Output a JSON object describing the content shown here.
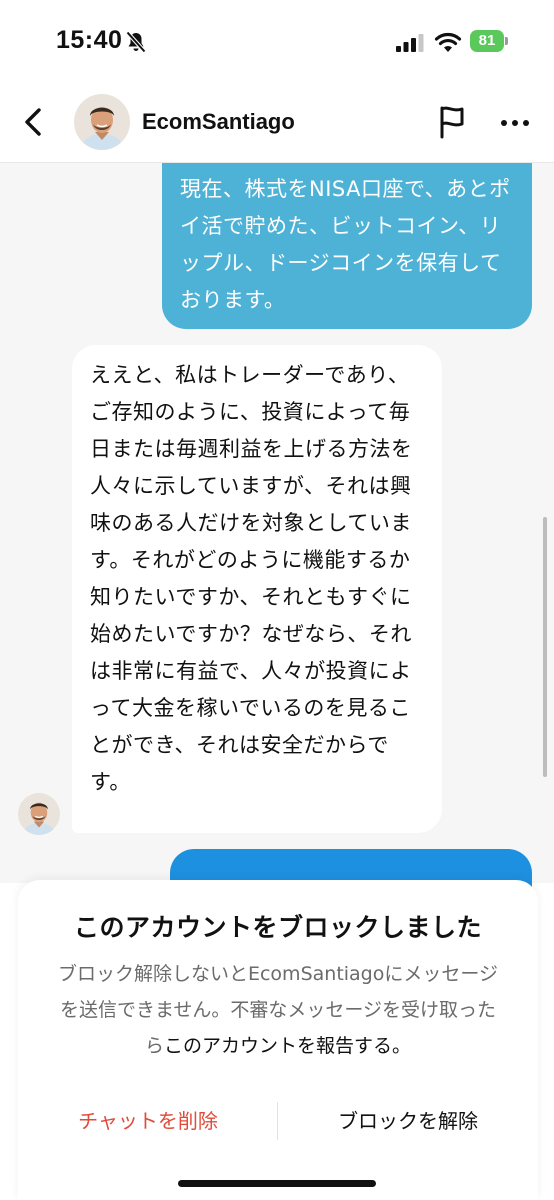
{
  "status_bar": {
    "time": "15:40",
    "battery": "81",
    "icons": [
      "bell-slash-icon",
      "signal-icon",
      "wifi-icon",
      "battery-icon"
    ],
    "battery_color": "#5ac85a"
  },
  "header": {
    "username": "EcomSantiago",
    "icons": [
      "chevron-left-icon",
      "flag-icon",
      "more-icon"
    ]
  },
  "messages": {
    "outgoing_1": "現在、株式をNISA口座で、あとポイ活で貯めた、ビットコイン、リップル、ドージコインを保有しております。",
    "incoming_1": "ええと、私はトレーダーであり、ご存知のように、投資によって毎日または毎週利益を上げる方法を人々に示していますが、それは興味のある人だけを対象としています。それがどのように機能するか知りたいですか、それともすぐに始めたいですか？なぜなら、それは非常に有益で、人々が投資によって大金を稼いでいるのを見ることができ、それは安全だからです。",
    "outgoing_color": "#4eb2d6",
    "incoming_color": "#ffffff"
  },
  "block_card": {
    "title": "このアカウントをブロックしました",
    "body_text": "ブロック解除しないとEcomSantiagoにメッセージを送信できません。不審なメッセージを受け取ったら",
    "report_link": "このアカウントを報告する。",
    "delete_chat_label": "チャットを削除",
    "unblock_label": "ブロックを解除",
    "delete_color": "#e04b3a"
  }
}
